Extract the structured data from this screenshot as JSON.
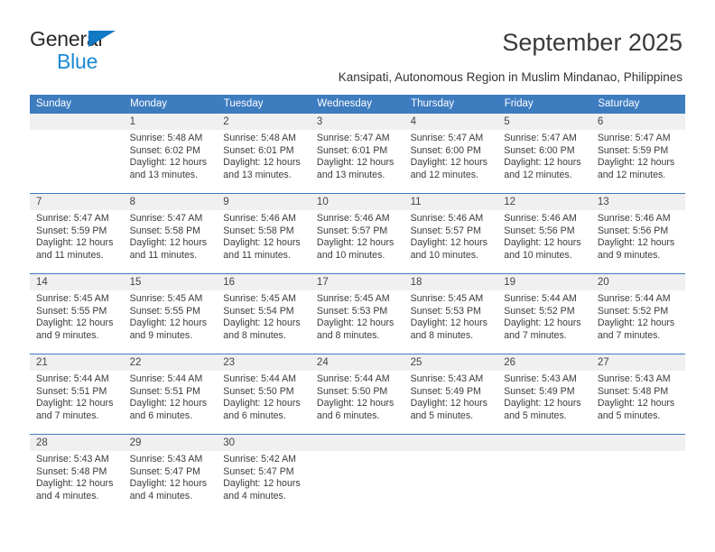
{
  "brand": {
    "name_part1": "General",
    "name_part2": "Blue"
  },
  "header": {
    "month_title": "September 2025",
    "subtitle": "Kansipati, Autonomous Region in Muslim Mindanao, Philippines"
  },
  "colors": {
    "header_blue": "#3e7cc0",
    "logo_blue": "#1b8ad4",
    "date_band": "#f0f0f0"
  },
  "weekdays": [
    "Sunday",
    "Monday",
    "Tuesday",
    "Wednesday",
    "Thursday",
    "Friday",
    "Saturday"
  ],
  "weeks": [
    [
      {
        "date": "",
        "empty": true,
        "sunrise": "",
        "sunset": "",
        "daylight": ""
      },
      {
        "date": "1",
        "sunrise": "Sunrise: 5:48 AM",
        "sunset": "Sunset: 6:02 PM",
        "daylight": "Daylight: 12 hours and 13 minutes."
      },
      {
        "date": "2",
        "sunrise": "Sunrise: 5:48 AM",
        "sunset": "Sunset: 6:01 PM",
        "daylight": "Daylight: 12 hours and 13 minutes."
      },
      {
        "date": "3",
        "sunrise": "Sunrise: 5:47 AM",
        "sunset": "Sunset: 6:01 PM",
        "daylight": "Daylight: 12 hours and 13 minutes."
      },
      {
        "date": "4",
        "sunrise": "Sunrise: 5:47 AM",
        "sunset": "Sunset: 6:00 PM",
        "daylight": "Daylight: 12 hours and 12 minutes."
      },
      {
        "date": "5",
        "sunrise": "Sunrise: 5:47 AM",
        "sunset": "Sunset: 6:00 PM",
        "daylight": "Daylight: 12 hours and 12 minutes."
      },
      {
        "date": "6",
        "sunrise": "Sunrise: 5:47 AM",
        "sunset": "Sunset: 5:59 PM",
        "daylight": "Daylight: 12 hours and 12 minutes."
      }
    ],
    [
      {
        "date": "7",
        "sunrise": "Sunrise: 5:47 AM",
        "sunset": "Sunset: 5:59 PM",
        "daylight": "Daylight: 12 hours and 11 minutes."
      },
      {
        "date": "8",
        "sunrise": "Sunrise: 5:47 AM",
        "sunset": "Sunset: 5:58 PM",
        "daylight": "Daylight: 12 hours and 11 minutes."
      },
      {
        "date": "9",
        "sunrise": "Sunrise: 5:46 AM",
        "sunset": "Sunset: 5:58 PM",
        "daylight": "Daylight: 12 hours and 11 minutes."
      },
      {
        "date": "10",
        "sunrise": "Sunrise: 5:46 AM",
        "sunset": "Sunset: 5:57 PM",
        "daylight": "Daylight: 12 hours and 10 minutes."
      },
      {
        "date": "11",
        "sunrise": "Sunrise: 5:46 AM",
        "sunset": "Sunset: 5:57 PM",
        "daylight": "Daylight: 12 hours and 10 minutes."
      },
      {
        "date": "12",
        "sunrise": "Sunrise: 5:46 AM",
        "sunset": "Sunset: 5:56 PM",
        "daylight": "Daylight: 12 hours and 10 minutes."
      },
      {
        "date": "13",
        "sunrise": "Sunrise: 5:46 AM",
        "sunset": "Sunset: 5:56 PM",
        "daylight": "Daylight: 12 hours and 9 minutes."
      }
    ],
    [
      {
        "date": "14",
        "sunrise": "Sunrise: 5:45 AM",
        "sunset": "Sunset: 5:55 PM",
        "daylight": "Daylight: 12 hours and 9 minutes."
      },
      {
        "date": "15",
        "sunrise": "Sunrise: 5:45 AM",
        "sunset": "Sunset: 5:55 PM",
        "daylight": "Daylight: 12 hours and 9 minutes."
      },
      {
        "date": "16",
        "sunrise": "Sunrise: 5:45 AM",
        "sunset": "Sunset: 5:54 PM",
        "daylight": "Daylight: 12 hours and 8 minutes."
      },
      {
        "date": "17",
        "sunrise": "Sunrise: 5:45 AM",
        "sunset": "Sunset: 5:53 PM",
        "daylight": "Daylight: 12 hours and 8 minutes."
      },
      {
        "date": "18",
        "sunrise": "Sunrise: 5:45 AM",
        "sunset": "Sunset: 5:53 PM",
        "daylight": "Daylight: 12 hours and 8 minutes."
      },
      {
        "date": "19",
        "sunrise": "Sunrise: 5:44 AM",
        "sunset": "Sunset: 5:52 PM",
        "daylight": "Daylight: 12 hours and 7 minutes."
      },
      {
        "date": "20",
        "sunrise": "Sunrise: 5:44 AM",
        "sunset": "Sunset: 5:52 PM",
        "daylight": "Daylight: 12 hours and 7 minutes."
      }
    ],
    [
      {
        "date": "21",
        "sunrise": "Sunrise: 5:44 AM",
        "sunset": "Sunset: 5:51 PM",
        "daylight": "Daylight: 12 hours and 7 minutes."
      },
      {
        "date": "22",
        "sunrise": "Sunrise: 5:44 AM",
        "sunset": "Sunset: 5:51 PM",
        "daylight": "Daylight: 12 hours and 6 minutes."
      },
      {
        "date": "23",
        "sunrise": "Sunrise: 5:44 AM",
        "sunset": "Sunset: 5:50 PM",
        "daylight": "Daylight: 12 hours and 6 minutes."
      },
      {
        "date": "24",
        "sunrise": "Sunrise: 5:44 AM",
        "sunset": "Sunset: 5:50 PM",
        "daylight": "Daylight: 12 hours and 6 minutes."
      },
      {
        "date": "25",
        "sunrise": "Sunrise: 5:43 AM",
        "sunset": "Sunset: 5:49 PM",
        "daylight": "Daylight: 12 hours and 5 minutes."
      },
      {
        "date": "26",
        "sunrise": "Sunrise: 5:43 AM",
        "sunset": "Sunset: 5:49 PM",
        "daylight": "Daylight: 12 hours and 5 minutes."
      },
      {
        "date": "27",
        "sunrise": "Sunrise: 5:43 AM",
        "sunset": "Sunset: 5:48 PM",
        "daylight": "Daylight: 12 hours and 5 minutes."
      }
    ],
    [
      {
        "date": "28",
        "sunrise": "Sunrise: 5:43 AM",
        "sunset": "Sunset: 5:48 PM",
        "daylight": "Daylight: 12 hours and 4 minutes."
      },
      {
        "date": "29",
        "sunrise": "Sunrise: 5:43 AM",
        "sunset": "Sunset: 5:47 PM",
        "daylight": "Daylight: 12 hours and 4 minutes."
      },
      {
        "date": "30",
        "sunrise": "Sunrise: 5:42 AM",
        "sunset": "Sunset: 5:47 PM",
        "daylight": "Daylight: 12 hours and 4 minutes."
      },
      {
        "date": "",
        "empty": true,
        "sunrise": "",
        "sunset": "",
        "daylight": ""
      },
      {
        "date": "",
        "empty": true,
        "sunrise": "",
        "sunset": "",
        "daylight": ""
      },
      {
        "date": "",
        "empty": true,
        "sunrise": "",
        "sunset": "",
        "daylight": ""
      },
      {
        "date": "",
        "empty": true,
        "sunrise": "",
        "sunset": "",
        "daylight": ""
      }
    ]
  ]
}
